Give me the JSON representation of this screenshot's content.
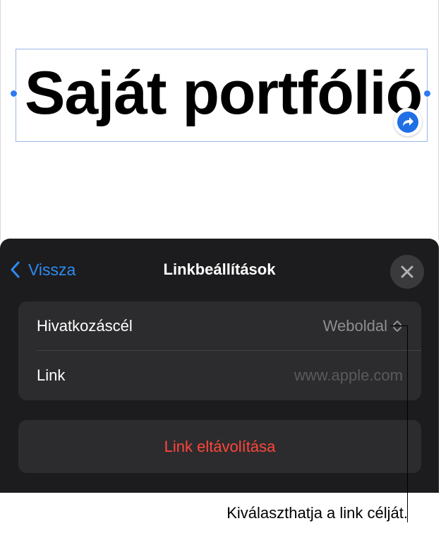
{
  "document": {
    "title": "Saját portfólió"
  },
  "sheet": {
    "back_label": "Vissza",
    "title": "Linkbeállítások",
    "rows": [
      {
        "label": "Hivatkozáscél",
        "value": "Weboldal"
      },
      {
        "label": "Link",
        "value": "www.apple.com"
      }
    ],
    "remove_label": "Link eltávolítása"
  },
  "callout": {
    "text": "Kiválaszthatja a link célját."
  },
  "icons": {
    "back": "chevron-left-icon",
    "close": "close-icon",
    "link_badge": "link-arrow-icon",
    "picker": "chevron-up-down-icon"
  },
  "colors": {
    "accent": "#2d8cf0",
    "destructive": "#ff453a",
    "sheet_bg": "#1c1c1e",
    "group_bg": "#2c2c2e"
  }
}
